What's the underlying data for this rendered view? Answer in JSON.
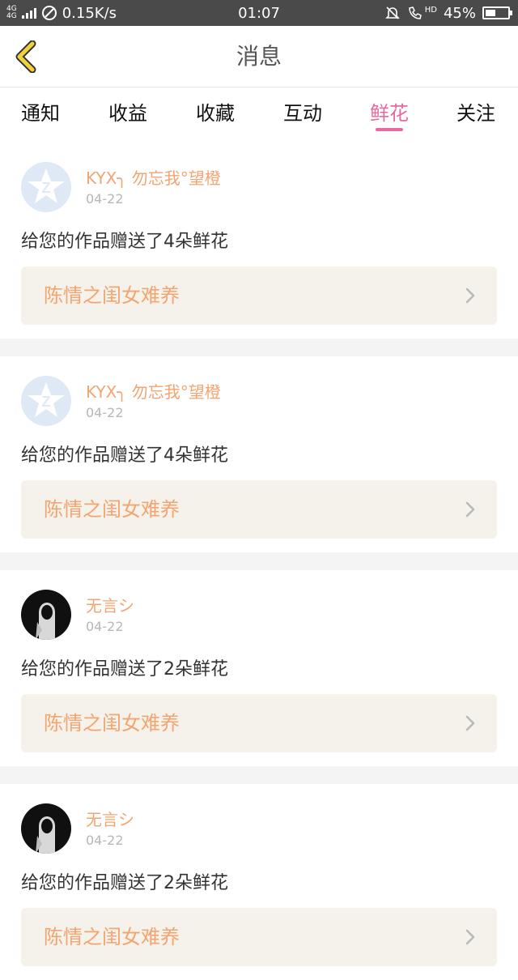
{
  "status_bar": {
    "network": "4G",
    "network2": "4G",
    "speed": "0.15K/s",
    "time": "01:07",
    "hd_label": "HD",
    "battery": "45%",
    "battery_level": 0.45
  },
  "header": {
    "title": "消息"
  },
  "tabs": [
    {
      "label": "通知"
    },
    {
      "label": "收益"
    },
    {
      "label": "收藏"
    },
    {
      "label": "互动"
    },
    {
      "label": "鲜花",
      "active": true
    },
    {
      "label": "关注"
    }
  ],
  "colors": {
    "accent": "#e66aa0",
    "username": "#f4a470",
    "card_bg": "#f4f2ea"
  },
  "messages": [
    {
      "avatar": "qq-avatar-icon",
      "user": "KYX╮ 勿忘我°望橙",
      "date": "04-22",
      "text": "给您的作品赠送了4朵鲜花",
      "work": "陈情之闺女难养"
    },
    {
      "avatar": "qq-avatar-icon",
      "user": "KYX╮ 勿忘我°望橙",
      "date": "04-22",
      "text": "给您的作品赠送了4朵鲜花",
      "work": "陈情之闺女难养"
    },
    {
      "avatar": "dark-avatar",
      "user": "无言シ",
      "date": "04-22",
      "text": "给您的作品赠送了2朵鲜花",
      "work": "陈情之闺女难养"
    },
    {
      "avatar": "dark-avatar",
      "user": "无言シ",
      "date": "04-22",
      "text": "给您的作品赠送了2朵鲜花",
      "work": "陈情之闺女难养"
    }
  ]
}
